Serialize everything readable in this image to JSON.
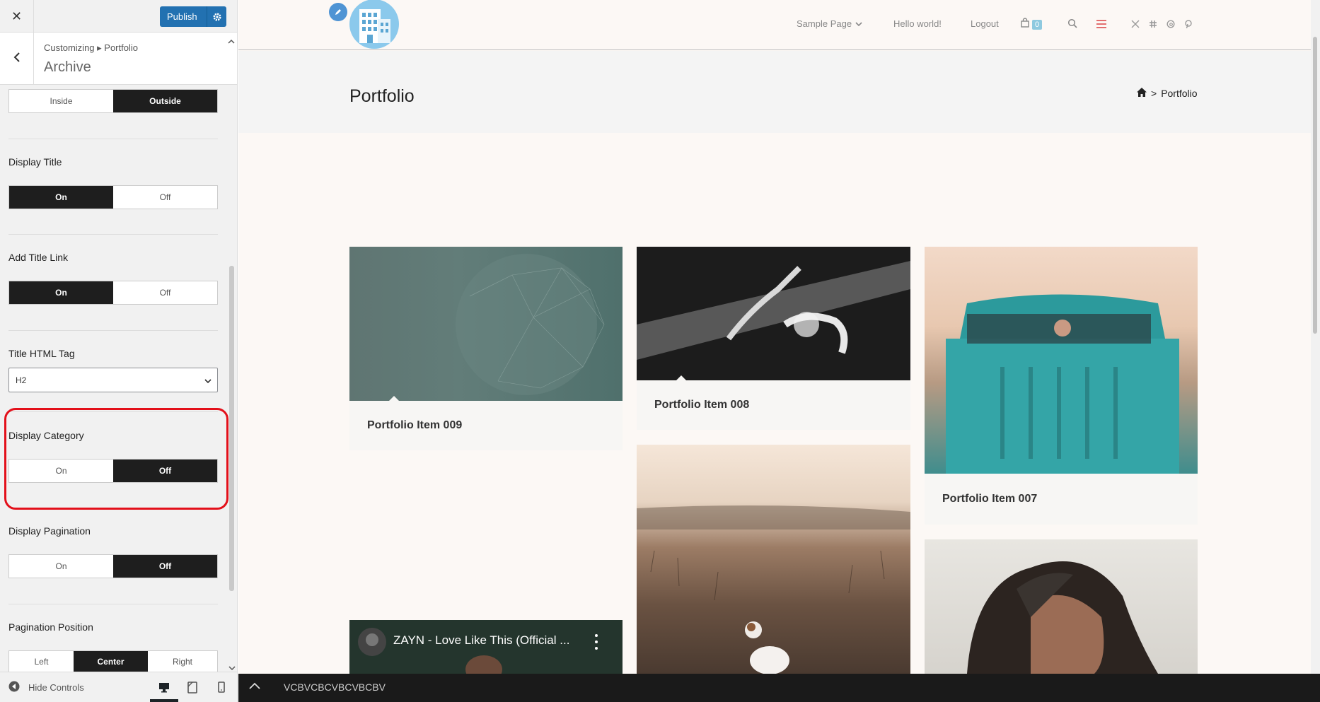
{
  "panel": {
    "close_label": "✕",
    "publish_label": "Publish",
    "breadcrumb": "Customizing ▸ Portfolio",
    "section_title": "Archive",
    "controls": {
      "position_toggle": {
        "options": [
          "Inside",
          "Outside"
        ],
        "selected": "Outside"
      },
      "display_title": {
        "label": "Display Title",
        "options": [
          "On",
          "Off"
        ],
        "selected": "On"
      },
      "add_title_link": {
        "label": "Add Title Link",
        "options": [
          "On",
          "Off"
        ],
        "selected": "On"
      },
      "title_html_tag": {
        "label": "Title HTML Tag",
        "value": "H2"
      },
      "display_category": {
        "label": "Display Category",
        "options": [
          "On",
          "Off"
        ],
        "selected": "Off"
      },
      "display_pagination": {
        "label": "Display Pagination",
        "options": [
          "On",
          "Off"
        ],
        "selected": "Off"
      },
      "pagination_position": {
        "label": "Pagination Position",
        "options": [
          "Left",
          "Center",
          "Right"
        ],
        "selected": "Center"
      }
    },
    "hide_controls_label": "Hide Controls"
  },
  "preview": {
    "nav": {
      "items": [
        "Sample Page",
        "Hello world!",
        "Logout"
      ],
      "cart_count": "0"
    },
    "page_title": "Portfolio",
    "breadcrumb_current": "Portfolio",
    "breadcrumb_sep": ">",
    "portfolio_items": [
      {
        "title": "Portfolio Item 009"
      },
      {
        "title": "Portfolio Item 008"
      },
      {
        "title": "Portfolio Item 007"
      }
    ],
    "video_title": "ZAYN - Love Like This (Official ...",
    "bottom_bar_text": "VCBVCBCVBCVBCBV"
  },
  "colors": {
    "publish_blue": "#2271b1",
    "active_toggle": "#1e1e1e",
    "highlight_red": "#e3101a",
    "cart_badge": "#8ec9df"
  }
}
